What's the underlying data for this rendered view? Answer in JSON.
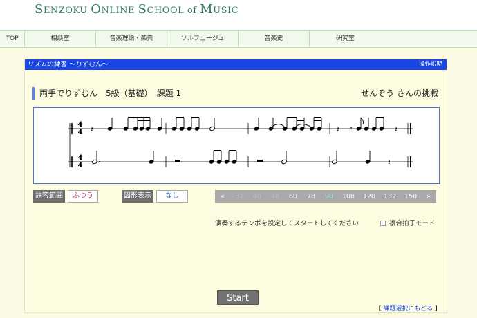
{
  "header": {
    "logo": "SENZOKU ONLINE SCHOOL of MUSIC",
    "logo_big1": "S",
    "logo_small1": "ENZOKU ",
    "logo_big2": "O",
    "logo_small2": "NLINE ",
    "logo_big3": "S",
    "logo_small3": "CHOOL of ",
    "logo_big4": "M",
    "logo_small4": "USIC"
  },
  "nav": [
    "TOP",
    "相談室",
    "音楽理論・楽典",
    "ソルフェージュ",
    "音楽史",
    "研究室"
  ],
  "panel": {
    "title": "リズムの練習 〜りずむん〜",
    "help_link": "操作説明",
    "exercise_title": "両手でりずむん　5級（基礎）　課題 1",
    "challenger": "せんぞう さんの挑戦"
  },
  "score": {
    "time_signature_top": "4",
    "time_signature_bottom": "4"
  },
  "controls": {
    "tolerance_label": "許容範囲",
    "tolerance_value": "ふつう",
    "shape_label": "図形表示",
    "shape_value": "なし",
    "tempo_prev": "«",
    "tempo_next": "»",
    "tempos": [
      "32",
      "40",
      "48",
      "60",
      "78",
      "90",
      "108",
      "120",
      "132",
      "150"
    ],
    "tempos_disabled": [
      "32",
      "40",
      "48"
    ],
    "tempo_selected": "90",
    "hint": "演奏するテンポを設定してスタートしてください",
    "composite_mode": "複合拍子モード",
    "start": "Start",
    "back_link": "課題選択にもどる",
    "back_bracket_open": "【",
    "back_bracket_close": "】"
  },
  "colors": {
    "brand_green": "#2e7d5b",
    "titlebar_blue": "#1947e6",
    "panel_bg": "#fdfce0",
    "selected_tempo": "#a0e6e6"
  }
}
